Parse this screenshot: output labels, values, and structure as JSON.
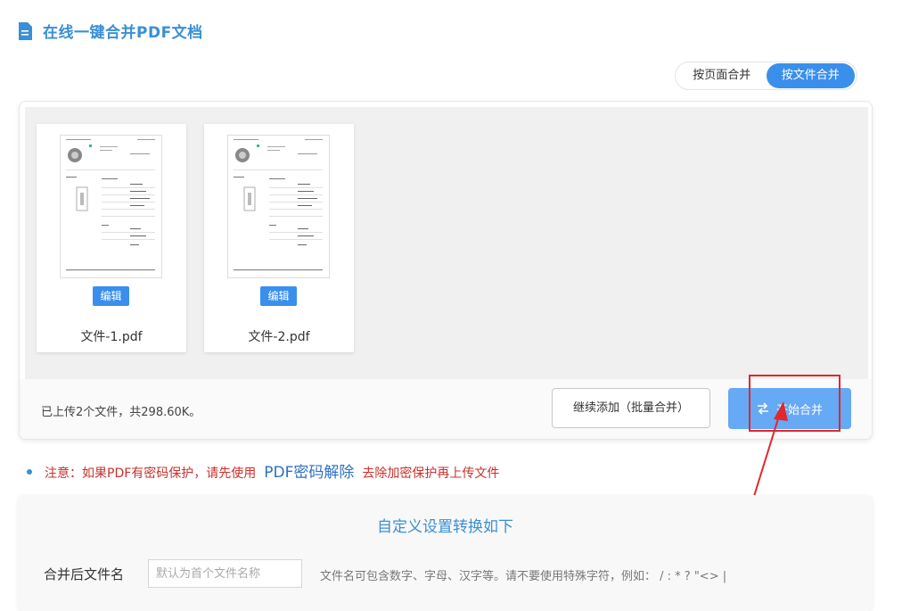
{
  "page_title": "在线一键合并PDF文档",
  "mode_toggle": {
    "page_mode": "按页面合并",
    "file_mode": "按文件合并",
    "active": "file_mode"
  },
  "files": [
    {
      "name": "文件-1.pdf",
      "edit_label": "编辑"
    },
    {
      "name": "文件-2.pdf",
      "edit_label": "编辑"
    }
  ],
  "status": {
    "upload_info": "已上传2个文件，共298.60K。",
    "add_more_label": "继续添加（批量合并）",
    "merge_label": "开始合并"
  },
  "notice": {
    "prefix": "注意：如果PDF有密码保护，请先使用",
    "link": "PDF密码解除",
    "suffix": "去除加密保护再上传文件"
  },
  "settings": {
    "title": "自定义设置转换如下",
    "field_label": "合并后文件名",
    "placeholder": "默认为首个文件名称",
    "hint": "文件名可包含数字、字母、汉字等。请不要使用特殊字符，例如：  / : * ? \"<> |"
  },
  "colors": {
    "accent": "#3a8fec",
    "title": "#3a8fd6",
    "notice": "#c9302c",
    "highlight": "#e0282d"
  }
}
